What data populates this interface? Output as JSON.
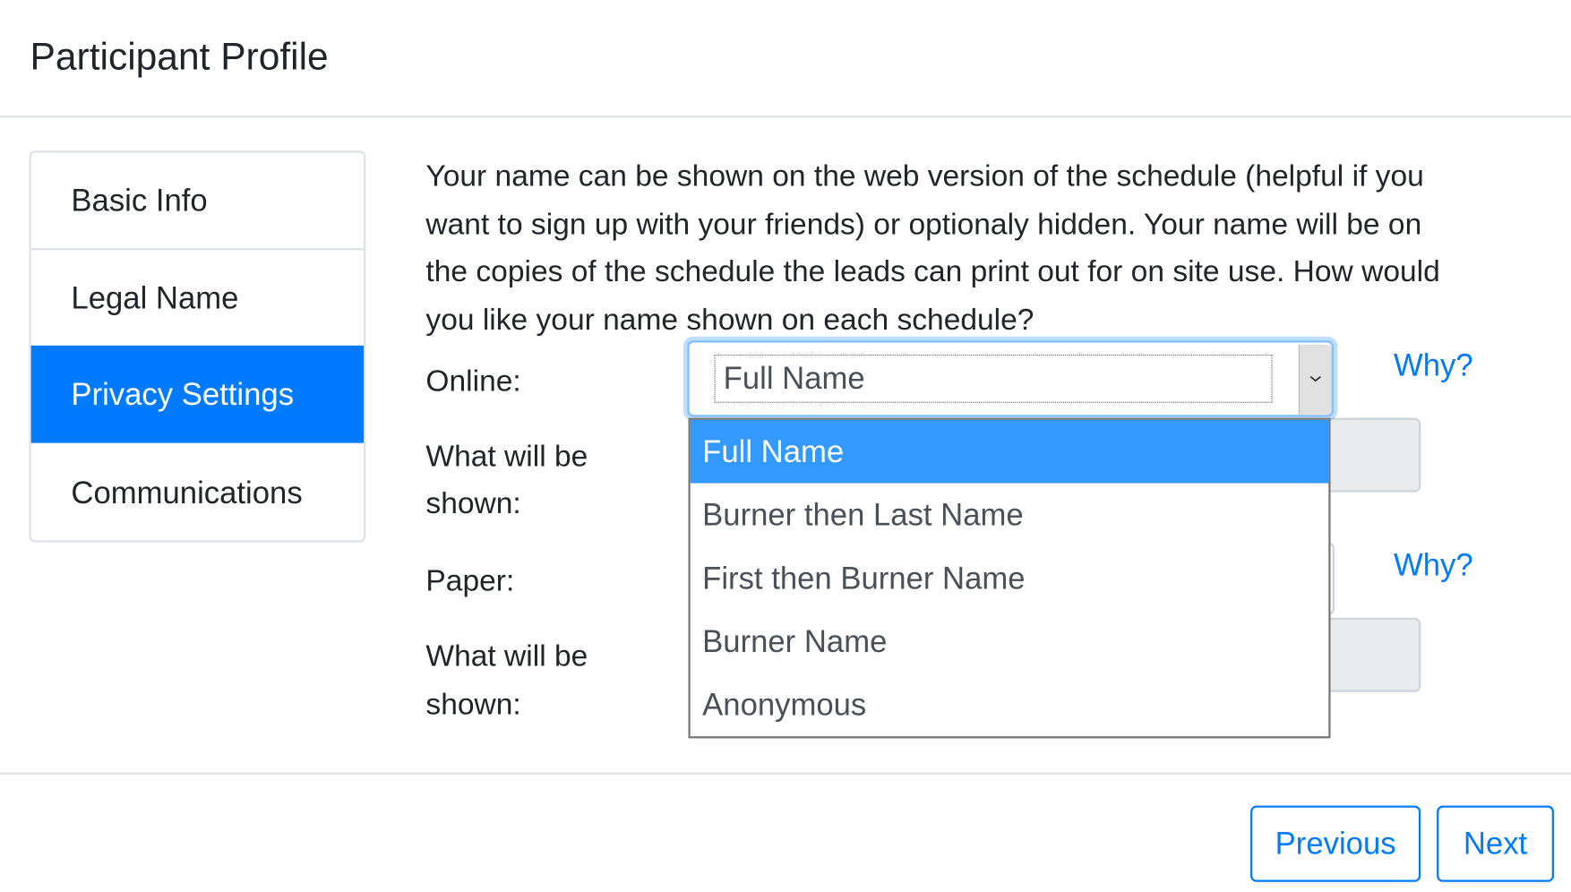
{
  "header": {
    "title": "Participant Profile"
  },
  "sidebar": {
    "items": [
      {
        "label": "Basic Info",
        "active": false
      },
      {
        "label": "Legal Name",
        "active": false
      },
      {
        "label": "Privacy Settings",
        "active": true
      },
      {
        "label": "Communications",
        "active": false
      }
    ]
  },
  "privacy": {
    "intro": "Your name can be shown on the web version of the schedule (helpful if you want to sign up with your friends) or optionaly hidden. Your name will be on the copies of the schedule the leads can print out for on site use. How would you like your name shown on each schedule?",
    "online": {
      "label": "Online:",
      "selected": "Full Name",
      "why_link": "Why?",
      "shown_label_line1": "What will be",
      "shown_label_line2": "shown:"
    },
    "paper": {
      "label": "Paper:",
      "why_link": "Why?",
      "shown_label_line1": "What will be",
      "shown_label_line2": "shown:"
    },
    "dropdown_options": [
      "Full Name",
      "Burner then Last Name",
      "First then Burner Name",
      "Burner Name",
      "Anonymous"
    ],
    "highlighted_option": "Full Name"
  },
  "footer": {
    "previous_label": "Previous",
    "next_label": "Next"
  },
  "colors": {
    "primary": "#007bff",
    "option_highlight": "#3399ff",
    "readonly_field": "#e9ecef",
    "border": "#dee2e6",
    "text": "#212529"
  },
  "icons": {
    "select_arrow": "chevron-down-icon"
  }
}
